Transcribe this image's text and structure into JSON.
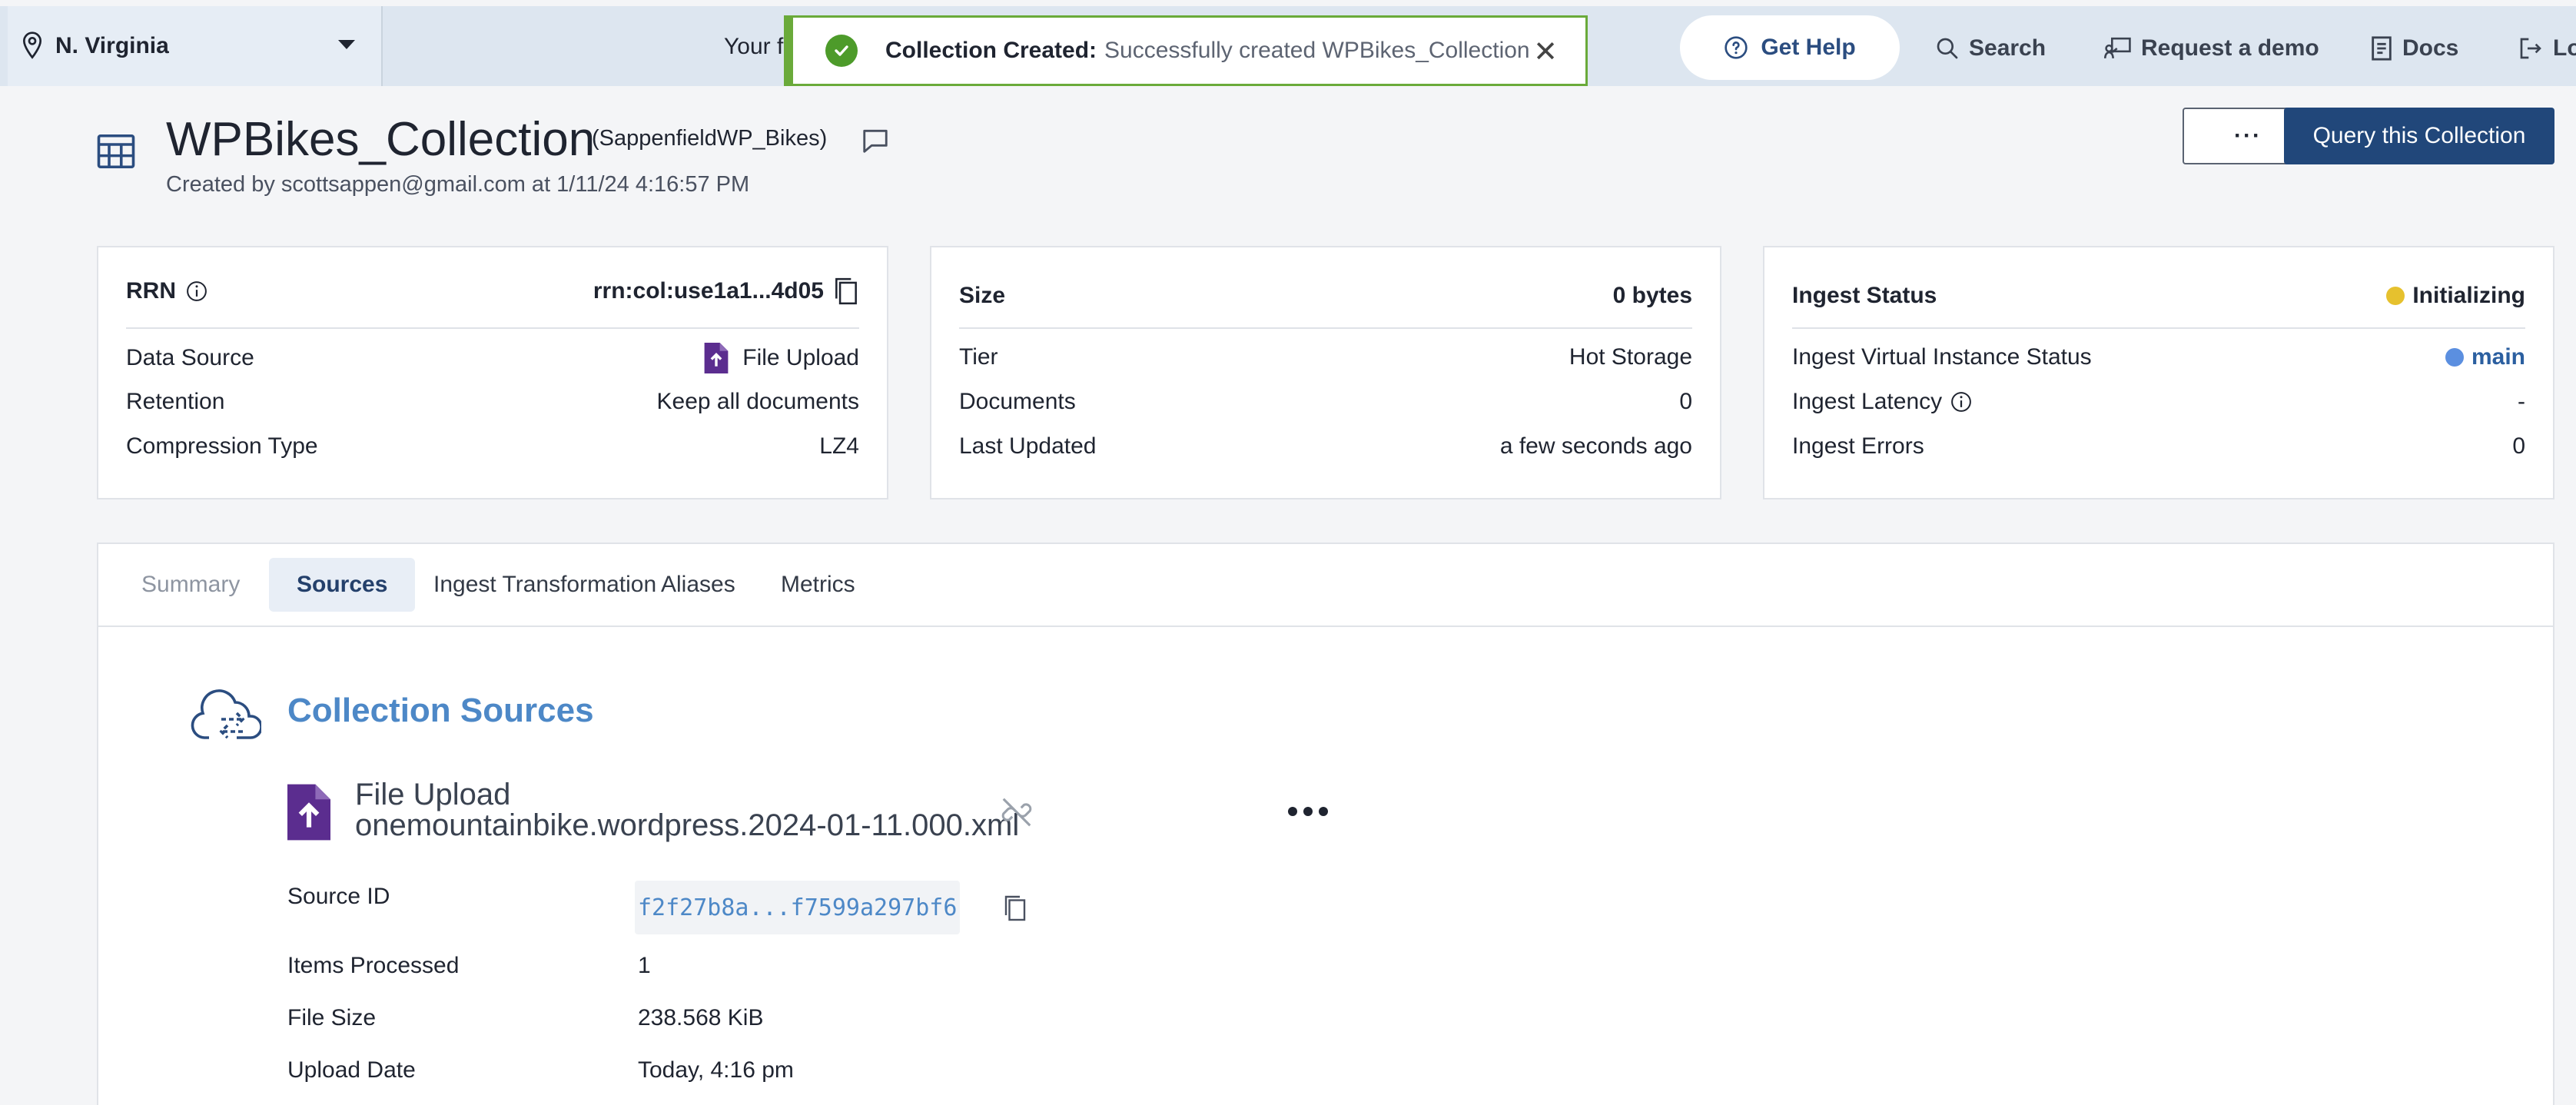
{
  "topbar": {
    "region": "N. Virginia",
    "banner_text": "Your f",
    "toast": {
      "title": "Collection Created:",
      "message": "Successfully created WPBikes_Collection"
    },
    "get_help": "Get Help",
    "search": "Search",
    "request_demo": "Request a demo",
    "docs": "Docs",
    "logout": "Lo"
  },
  "header": {
    "collection_name": "WPBikes_Collection",
    "workspace": "(SappenfieldWP_Bikes)",
    "created_by": "Created by scottsappen@gmail.com at 1/11/24 4:16:57 PM",
    "more_label": "···",
    "query_button": "Query this Collection"
  },
  "card1": {
    "rrn_label": "RRN",
    "rrn_value": "rrn:col:use1a1...4d05",
    "data_source_label": "Data Source",
    "data_source_value": "File Upload",
    "retention_label": "Retention",
    "retention_value": "Keep all documents",
    "compression_label": "Compression Type",
    "compression_value": "LZ4"
  },
  "card2": {
    "size_label": "Size",
    "size_value": "0 bytes",
    "tier_label": "Tier",
    "tier_value": "Hot Storage",
    "documents_label": "Documents",
    "documents_value": "0",
    "updated_label": "Last Updated",
    "updated_value": "a few seconds ago"
  },
  "card3": {
    "status_label": "Ingest Status",
    "status_value": "Initializing",
    "status_color": "#e6c12e",
    "vi_label": "Ingest Virtual Instance Status",
    "vi_value": "main",
    "vi_color": "#5b8fe0",
    "latency_label": "Ingest Latency",
    "latency_value": "-",
    "errors_label": "Ingest Errors",
    "errors_value": "0"
  },
  "tabs": [
    "Summary",
    "Sources",
    "Ingest Transformation",
    "Aliases",
    "Metrics"
  ],
  "sources": {
    "title": "Collection Sources",
    "type": "File Upload",
    "file_name": "onemountainbike.wordpress.2024-01-11.000.xml",
    "source_id_label": "Source ID",
    "source_id_value": "f2f27b8a...f7599a297bf6",
    "items_label": "Items Processed",
    "items_value": "1",
    "size_label": "File Size",
    "size_value": "238.568 KiB",
    "date_label": "Upload Date",
    "date_value": "Today, 4:16 pm"
  },
  "colors": {
    "accent": "#21477a",
    "link": "#4d88c7",
    "success": "#4d9b2a",
    "file_icon": "#5b2d8f"
  }
}
